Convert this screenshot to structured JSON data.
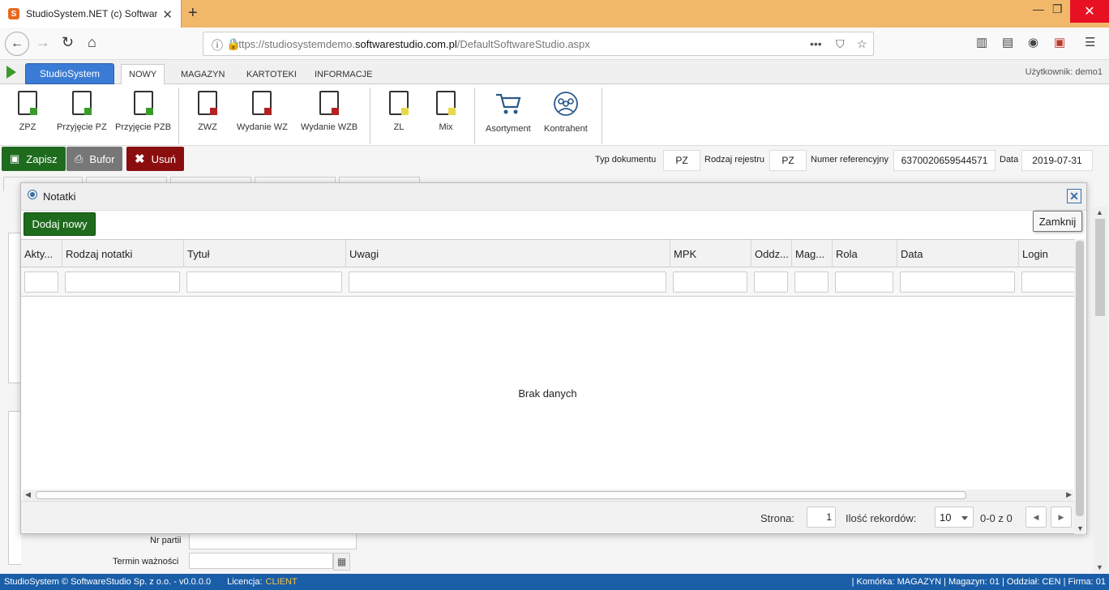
{
  "browser": {
    "tab_title": "StudioSystem.NET (c) Software",
    "url_prefix": "https://studiosystemdemo.",
    "url_domain": "softwarestudio.com.pl",
    "url_path": "/DefaultSoftwareStudio.aspx"
  },
  "app": {
    "brand_button": "StudioSystem",
    "menu": [
      "NOWY",
      "MAGAZYN",
      "KARTOTEKI",
      "INFORMACJE"
    ],
    "user_label": "Użytkownik: demo1"
  },
  "ribbon": {
    "items": [
      {
        "label": "ZPZ",
        "icon": "doc-green-icon",
        "color": "#3a9a2a"
      },
      {
        "label": "Przyjęcie PZ",
        "icon": "doc-green-icon",
        "color": "#3a9a2a"
      },
      {
        "label": "Przyjęcie PZB",
        "icon": "doc-green-icon",
        "color": "#3a9a2a"
      },
      {
        "label": "ZWZ",
        "icon": "doc-red-icon",
        "color": "#b22222"
      },
      {
        "label": "Wydanie WZ",
        "icon": "doc-red-icon",
        "color": "#b22222"
      },
      {
        "label": "Wydanie WZB",
        "icon": "doc-red-icon",
        "color": "#b22222"
      },
      {
        "label": "ZL",
        "icon": "doc-yellow-icon",
        "color": "#e8d84a"
      },
      {
        "label": "Mix",
        "icon": "doc-yellow-icon",
        "color": "#e8d84a"
      },
      {
        "label": "Asortyment",
        "icon": "cart-icon"
      },
      {
        "label": "Kontrahent",
        "icon": "people-icon"
      }
    ]
  },
  "toolbar": {
    "save": "Zapisz",
    "buffer": "Bufor",
    "delete": "Usuń",
    "doc_type_label": "Typ dokumentu",
    "doc_type_value": "PZ",
    "register_label": "Rodzaj rejestru",
    "register_value": "PZ",
    "ref_label": "Numer referencyjny",
    "ref_value": "6370020659544571",
    "date_label": "Data",
    "date_value": "2019-07-31"
  },
  "background_form": {
    "batch_label": "Nr partii",
    "expiry_label": "Termin ważności"
  },
  "modal": {
    "title": "Notatki",
    "add_button": "Dodaj nowy",
    "close_tooltip": "Zamknij",
    "columns": [
      "Akty...",
      "Rodzaj notatki",
      "Tytuł",
      "Uwagi",
      "MPK",
      "Oddz...",
      "Mag...",
      "Rola",
      "Data",
      "Login"
    ],
    "empty_text": "Brak danych",
    "pager": {
      "page_label": "Strona:",
      "page_value": "1",
      "records_label": "Ilość rekordów:",
      "records_value": "10",
      "range_text": "0-0 z 0"
    }
  },
  "status": {
    "copyright": "StudioSystem © SoftwareStudio Sp. z o.o. - v0.0.0.0",
    "license_label": "Licencja:",
    "license_value": "CLIENT",
    "context": "| Komórka: MAGAZYN | Magazyn: 01 | Oddział: CEN | Firma: 01"
  }
}
